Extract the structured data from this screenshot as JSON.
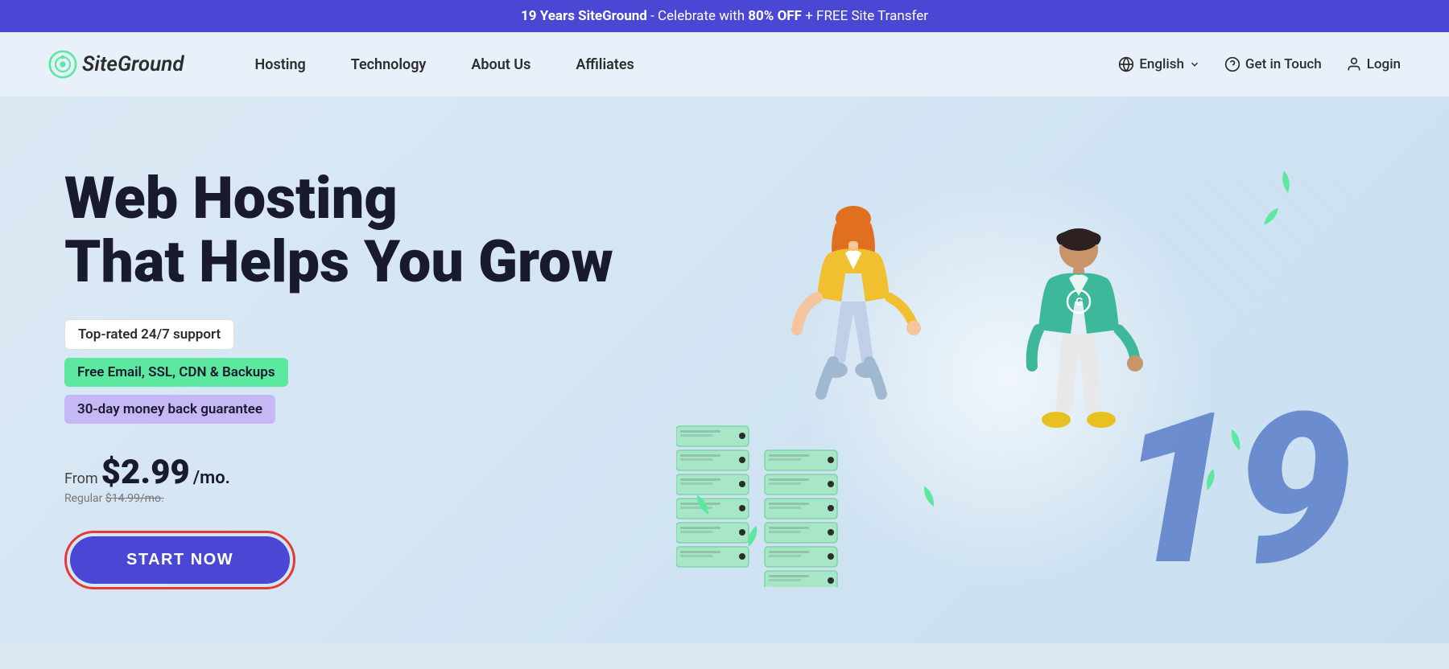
{
  "banner": {
    "text_plain": "19 Years SiteGround",
    "text_strong1": "19 Years SiteGround",
    "text_middle": " - Celebrate with ",
    "text_strong2": "80% OFF",
    "text_end": " + FREE Site Transfer"
  },
  "nav": {
    "logo_text": "SiteGround",
    "links": [
      {
        "label": "Hosting",
        "id": "hosting"
      },
      {
        "label": "Technology",
        "id": "technology"
      },
      {
        "label": "About Us",
        "id": "about-us"
      },
      {
        "label": "Affiliates",
        "id": "affiliates"
      }
    ],
    "right": {
      "language_label": "English",
      "support_label": "Get in Touch",
      "login_label": "Login"
    }
  },
  "hero": {
    "title_line1": "Web Hosting",
    "title_line2": "That Helps You Grow",
    "badges": [
      {
        "text": "Top-rated 24/7 support",
        "style": "white"
      },
      {
        "text": "Free Email, SSL, CDN & Backups",
        "style": "green"
      },
      {
        "text": "30-day money back guarantee",
        "style": "purple"
      }
    ],
    "price_from": "From",
    "price_value": "$2.99",
    "price_period": "/mo.",
    "price_regular_label": "Regular",
    "price_regular_value": "$14.99/mo.",
    "cta_button": "START NOW",
    "anniversary_number": "19"
  },
  "colors": {
    "banner_bg": "#4a47d5",
    "cta_bg": "#4a47d5",
    "badge_green": "#5de8a0",
    "badge_purple": "#c5b8f5",
    "hero_bg": "#dce9f5",
    "big19_color": "#5b7ec9"
  }
}
